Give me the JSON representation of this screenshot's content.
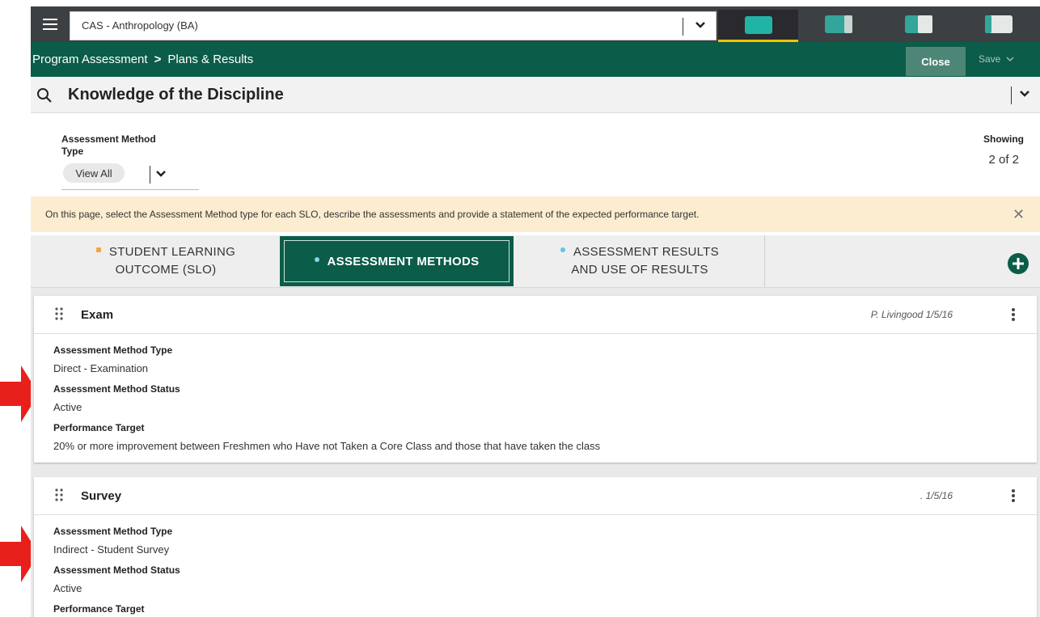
{
  "topbar": {
    "program": "CAS - Anthropology (BA)",
    "view_tiles": [
      "view-layout-1",
      "view-layout-2",
      "view-layout-3",
      "view-layout-4"
    ]
  },
  "breadcrumb": {
    "root": "Program Assessment",
    "separator": ">",
    "current": "Plans & Results"
  },
  "actions": {
    "close_label": "Close",
    "save_label": "Save"
  },
  "search": {
    "title": "Knowledge of the Discipline"
  },
  "filter": {
    "label_line1": "Assessment Method",
    "label_line2": "Type",
    "value": "View All"
  },
  "showing": {
    "label": "Showing",
    "count": "2 of 2"
  },
  "banner": {
    "text": "On this page, select the Assessment Method type for each SLO, describe the assessments and provide a statement of the expected performance target."
  },
  "tabs": {
    "slo_line1": "STUDENT LEARNING",
    "slo_line2": "OUTCOME (SLO)",
    "methods": "ASSESSMENT METHODS",
    "results_line1": "ASSESSMENT RESULTS",
    "results_line2": "AND USE OF RESULTS"
  },
  "cards": [
    {
      "name": "Exam",
      "meta": "P. Livingood 1/5/16",
      "type_label": "Assessment Method Type",
      "type_value": "Direct - Examination",
      "status_label": "Assessment Method Status",
      "status_value": "Active",
      "target_label": "Performance Target",
      "target_value": "20% or more improvement between Freshmen who Have not Taken a Core Class and those that have taken the class"
    },
    {
      "name": "Survey",
      "meta": ". 1/5/16",
      "type_label": "Assessment Method Type",
      "type_value": "Indirect - Student Survey",
      "status_label": "Assessment Method Status",
      "status_value": "Active",
      "target_label": "Performance Target"
    }
  ],
  "colors": {
    "brand_green": "#0b5c48",
    "topbar": "#3c4043",
    "banner": "#fdedd0",
    "accent_teal": "#21b3a5",
    "annotation_red": "#e8201c"
  }
}
